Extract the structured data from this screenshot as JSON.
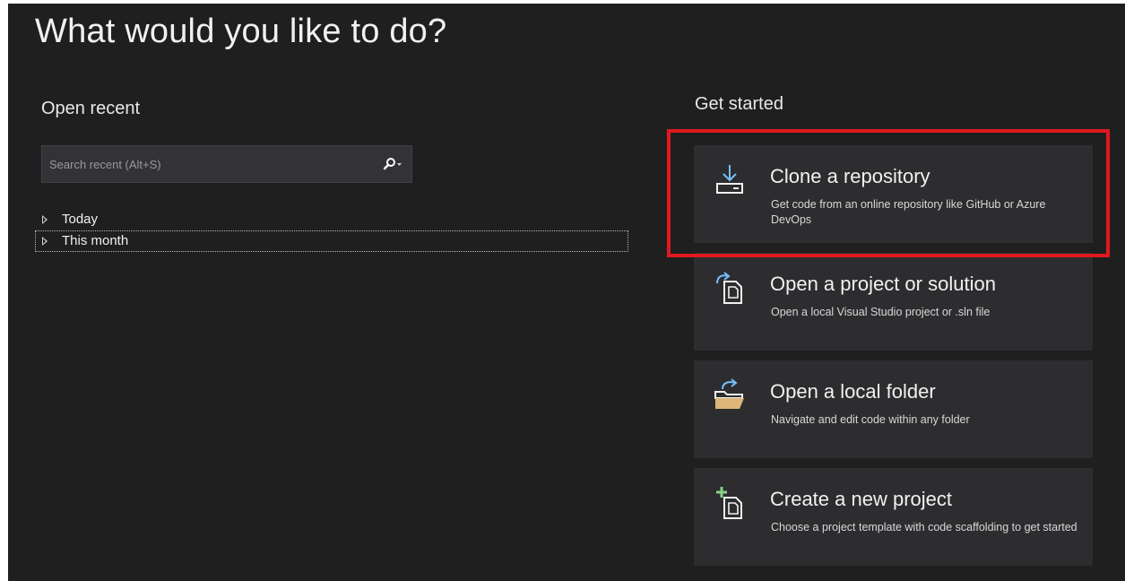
{
  "page": {
    "title": "What would you like to do?"
  },
  "open_recent": {
    "title": "Open recent",
    "search": {
      "placeholder": "Search recent (Alt+S)"
    },
    "groups": [
      {
        "label": "Today"
      },
      {
        "label": "This month"
      }
    ]
  },
  "get_started": {
    "title": "Get started",
    "cards": [
      {
        "title": "Clone a repository",
        "description": "Get code from an online repository like GitHub or Azure DevOps",
        "icon": "clone-download-icon"
      },
      {
        "title": "Open a project or solution",
        "description": "Open a local Visual Studio project or .sln file",
        "icon": "open-project-icon"
      },
      {
        "title": "Open a local folder",
        "description": "Navigate and edit code within any folder",
        "icon": "open-folder-icon"
      },
      {
        "title": "Create a new project",
        "description": "Choose a project template with code scaffolding to get started",
        "icon": "new-project-icon"
      }
    ]
  },
  "colors": {
    "background": "#1f1f1f",
    "card": "#2d2d30",
    "accent_blue": "#75beff",
    "accent_green": "#89d185",
    "folder_yellow": "#dcb67a",
    "highlight_red": "#e0181f"
  }
}
